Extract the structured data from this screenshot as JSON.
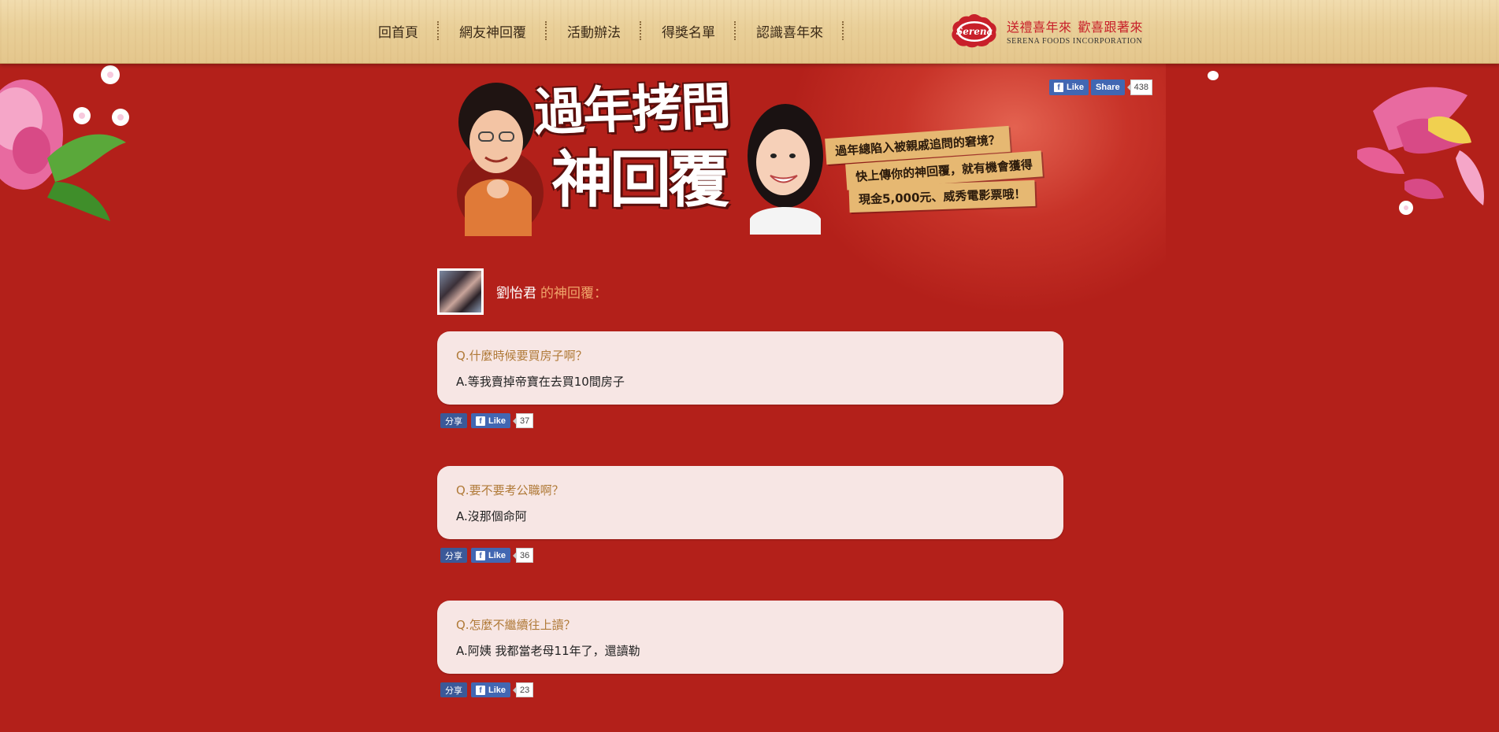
{
  "nav": {
    "items": [
      {
        "label": "回首頁"
      },
      {
        "label": "網友神回覆"
      },
      {
        "label": "活動辦法"
      },
      {
        "label": "得獎名單"
      },
      {
        "label": "認識喜年來"
      }
    ]
  },
  "brand": {
    "logo_text": "Serena",
    "slogan_1": "送禮喜年來",
    "slogan_2": "歡喜跟著來",
    "company": "SERENA FOODS INCORPORATION"
  },
  "social_top": {
    "like_label": "Like",
    "share_label": "Share",
    "count": "438"
  },
  "banner": {
    "title_line1": "過年拷問",
    "title_line2": "神回覆",
    "tagline_1": "過年總陷入被親戚追問的窘境？",
    "tagline_2": "快上傳你的神回覆，就有機會獲得",
    "tagline_3": "現金5,000元、威秀電影票哦！"
  },
  "author": {
    "name": "劉怡君",
    "suffix": "的神回覆："
  },
  "answers": [
    {
      "question": "Q.什麼時候要買房子啊？",
      "answer": "A.等我賣掉帝寶在去買10間房子",
      "share_label": "分享",
      "like_label": "Like",
      "like_count": "37"
    },
    {
      "question": "Q.要不要考公職啊？",
      "answer": "A.沒那個命阿",
      "share_label": "分享",
      "like_label": "Like",
      "like_count": "36"
    },
    {
      "question": "Q.怎麼不繼續往上讀？",
      "answer": "A.阿姨 我都當老母11年了，還讀勒",
      "share_label": "分享",
      "like_label": "Like",
      "like_count": "23"
    }
  ],
  "colors": {
    "background": "#b3201a",
    "card": "#f7e6e4",
    "question": "#b07a38",
    "facebook": "#4267b2"
  }
}
